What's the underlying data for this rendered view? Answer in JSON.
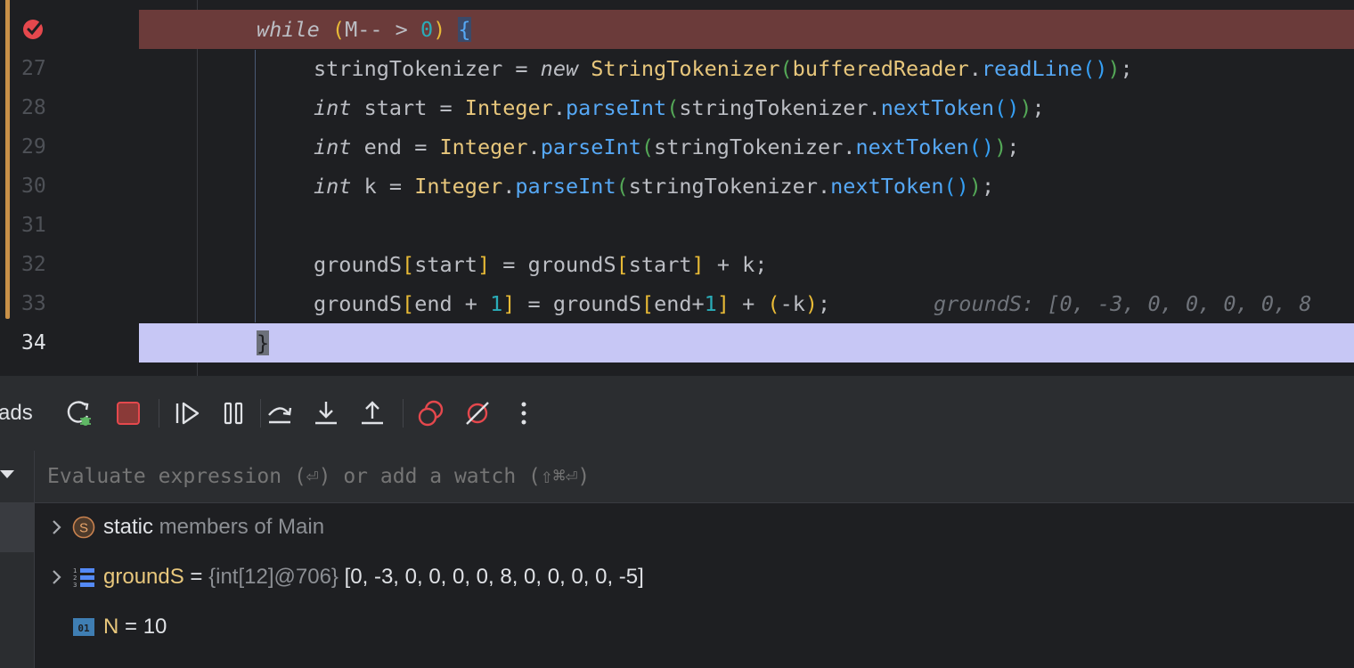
{
  "editor": {
    "lines": [
      {
        "number": "",
        "breakpoint": true,
        "kw": "while",
        "rest": "(M-- > 0) {"
      },
      {
        "number": "27"
      },
      {
        "number": "28"
      },
      {
        "number": "29"
      },
      {
        "number": "30"
      },
      {
        "number": "31"
      },
      {
        "number": "32"
      },
      {
        "number": "33",
        "inlay": "groundS: [0, -3, 0, 0, 0, 0, 8"
      },
      {
        "number": "34",
        "current": true,
        "code": "}"
      }
    ],
    "tokens": {
      "kw_while": "while",
      "M_dec": "M-- > ",
      "zero": "0",
      "l27_a": "stringTokenizer = ",
      "l27_new": "new",
      "l27_cls": "StringTokenizer",
      "l27_arg": "bufferedReader",
      "l27_fn": "readLine",
      "int": "int",
      "start": " start = ",
      "end": " end = ",
      "k": " k = ",
      "Integer": "Integer",
      "parseInt": "parseInt",
      "stok": "stringTokenizer",
      "nextToken": "nextToken",
      "gs": "groundS",
      "start_idx": "start",
      "plus_k": " + k;",
      "end_idx": "end + ",
      "end_idx2": "end+",
      "one": "1",
      "neg_k": "-k"
    }
  },
  "toolbar": {
    "threads_label": "ads",
    "buttons": [
      "rerun-debug-icon",
      "stop-icon",
      "resume-icon",
      "pause-icon",
      "step-over-icon",
      "step-into-icon",
      "step-out-icon",
      "view-breakpoints-icon",
      "mute-breakpoints-icon",
      "more-icon"
    ]
  },
  "variables": {
    "eval_placeholder": "Evaluate expression (⏎) or add a watch (⇧⌘⏎)",
    "items": [
      {
        "keyword": "static",
        "label": " members of Main",
        "icon": "static-members-icon"
      },
      {
        "name": "groundS",
        "eq": " = ",
        "type": "{int[12]@706}",
        "value": " [0, -3, 0, 0, 0, 0, 8, 0, 0, 0, 0, -5]",
        "icon": "array-icon"
      },
      {
        "name": "N",
        "eq": " = ",
        "value": "10",
        "icon": "primitive-icon"
      }
    ]
  },
  "colors": {
    "breakpoint_line": "#6b3b3a",
    "execution_point_line": "#c7c7f5",
    "change_marker": "#c99148"
  }
}
